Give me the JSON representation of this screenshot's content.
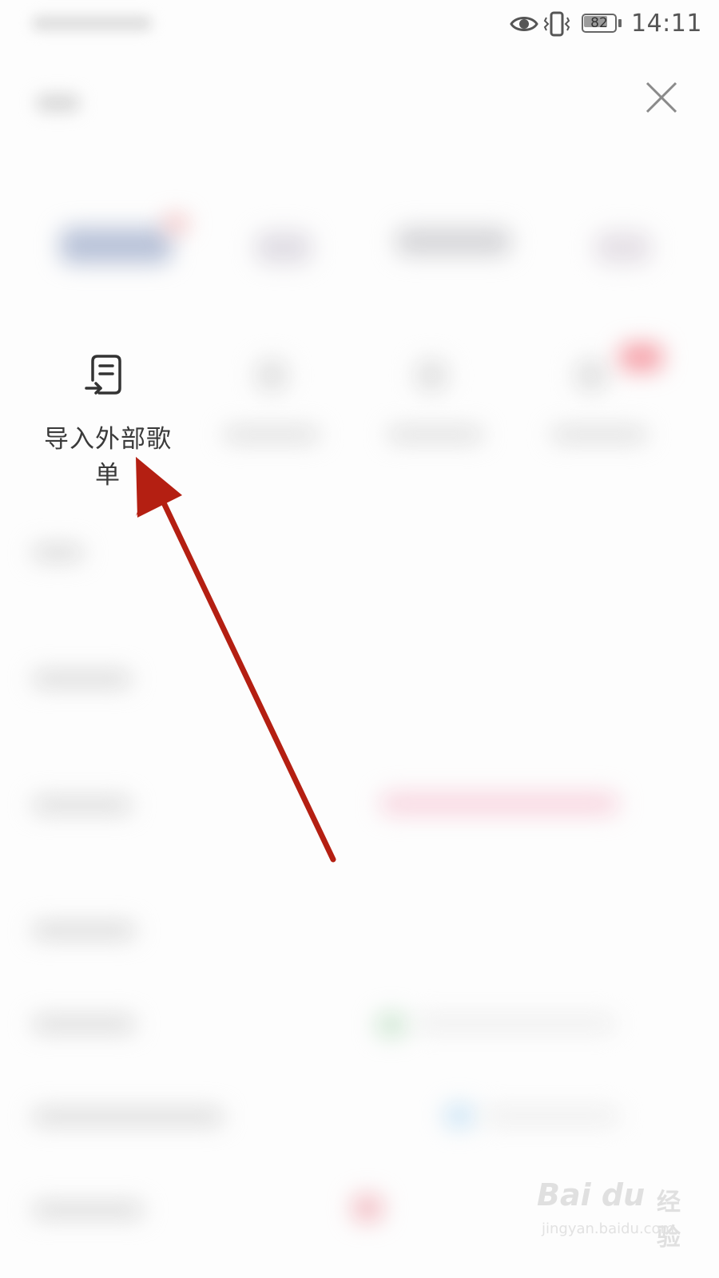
{
  "status_bar": {
    "battery_level": "82",
    "time": "14:11",
    "icons": [
      "eye-icon",
      "vibrate-icon",
      "battery-icon"
    ]
  },
  "close": {
    "icon": "close-icon"
  },
  "import_item": {
    "label": "导入外部歌单",
    "icon": "import-playlist-icon"
  },
  "annotation": {
    "color": "#b41f12"
  },
  "watermark": {
    "logo": "Bai du",
    "sub": "经验",
    "url": "jingyan.baidu.com"
  }
}
